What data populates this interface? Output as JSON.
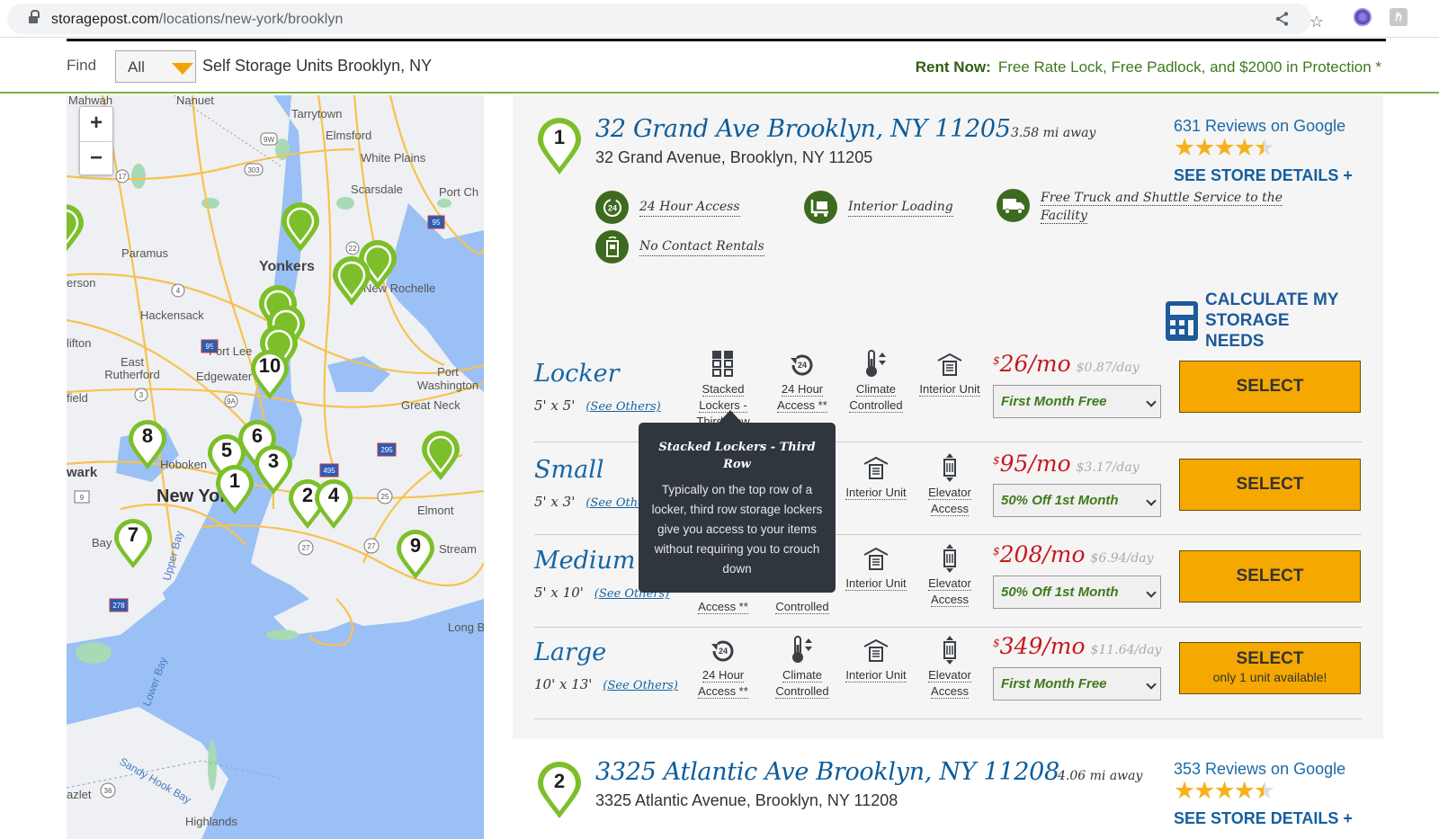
{
  "browser": {
    "url_host": "storagepost.com",
    "url_path": "/locations/new-york/brooklyn",
    "icons": [
      "lock-icon",
      "share-icon",
      "bookmark-star-icon",
      "extension-icon",
      "profile-icon"
    ]
  },
  "findbar": {
    "find_label": "Find",
    "filter_value": "All",
    "title": "Self Storage Units Brooklyn, NY",
    "rent_now_label": "Rent Now:",
    "rent_now_text": "Free Rate Lock, Free Padlock, and $2000 in Protection *"
  },
  "map": {
    "zoom_in": "+",
    "zoom_out": "−",
    "labels": [
      {
        "text": "Mahwah"
      },
      {
        "text": "Nanuet"
      },
      {
        "text": "Tarrytown"
      },
      {
        "text": "Elmsford"
      },
      {
        "text": "White Plains"
      },
      {
        "text": "Scarsdale"
      },
      {
        "text": "Port Ch"
      },
      {
        "text": "Paramus"
      },
      {
        "text": "Yonkers"
      },
      {
        "text": "erson"
      },
      {
        "text": "Hackensack"
      },
      {
        "text": "New Rochelle"
      },
      {
        "text": "lifton"
      },
      {
        "text": "Fort Lee"
      },
      {
        "text": "East Rutherford"
      },
      {
        "text": "Edgewater"
      },
      {
        "text": "Port Washington"
      },
      {
        "text": "Great Neck"
      },
      {
        "text": "field"
      },
      {
        "text": "Hoboken"
      },
      {
        "text": "wark"
      },
      {
        "text": "New York"
      },
      {
        "text": "Elmont"
      },
      {
        "text": "Stream"
      },
      {
        "text": "Bay"
      },
      {
        "text": "Upper Bay"
      },
      {
        "text": "Long B"
      },
      {
        "text": "Lower Bay"
      },
      {
        "text": "Sandy Hook Bay"
      },
      {
        "text": "azlet"
      },
      {
        "text": "Highlands"
      }
    ],
    "route_shields": [
      "9W",
      "303",
      "17",
      "4",
      "22",
      "95",
      "3",
      "9A",
      "295",
      "495",
      "25",
      "27",
      "27",
      "9",
      "278",
      "36"
    ],
    "numbered_pins": [
      "10",
      "8",
      "5",
      "6",
      "3",
      "1",
      "2",
      "4",
      "7",
      "9"
    ],
    "pin_color": "#7cbf2a"
  },
  "stores": [
    {
      "pin": "1",
      "title": "32 Grand Ave Brooklyn, NY 11205",
      "distance": "3.58 mi away",
      "address": "32 Grand Avenue, Brooklyn, NY 11205",
      "reviews": "631 Reviews on Google",
      "rating": 4.5,
      "details_link": "SEE STORE DETAILS +",
      "amenities": [
        {
          "icon": "24-hour-icon",
          "label": "24 Hour Access"
        },
        {
          "icon": "interior-loading-icon",
          "label": "Interior Loading"
        },
        {
          "icon": "truck-icon",
          "label": "Free Truck and Shuttle Service to the Facility"
        },
        {
          "icon": "no-contact-icon",
          "label": "No Contact Rentals"
        }
      ],
      "calculator": "CALCULATE MY STORAGE NEEDS",
      "units": [
        {
          "name": "Locker",
          "size": "5' x 5'",
          "see_others": "(See Others)",
          "features": [
            {
              "icon": "stacked-lockers-icon",
              "label": "Stacked Lockers - Third Row"
            },
            {
              "icon": "24-hour-icon",
              "label": "24 Hour Access **"
            },
            {
              "icon": "climate-icon",
              "label": "Climate Controlled"
            },
            {
              "icon": "interior-unit-icon",
              "label": "Interior Unit"
            }
          ],
          "price": "26/mo",
          "currency": "$",
          "per_day": "$0.87/day",
          "promo": "First Month Free",
          "select": "SELECT",
          "select_note": ""
        },
        {
          "name": "Small",
          "size": "5' x 3'",
          "see_others": "(See Others)",
          "features": [
            {
              "icon": "interior-unit-icon",
              "label": "Interior Unit"
            },
            {
              "icon": "elevator-icon",
              "label": "Elevator Access"
            }
          ],
          "price": "95/mo",
          "currency": "$",
          "per_day": "$3.17/day",
          "promo": "50% Off 1st Month",
          "select": "SELECT",
          "select_note": ""
        },
        {
          "name": "Medium",
          "size": "5' x 10'",
          "see_others": "(See Others)",
          "features": [
            {
              "icon": "24-hour-icon",
              "label": "Access **"
            },
            {
              "icon": "climate-icon",
              "label": "Controlled"
            },
            {
              "icon": "interior-unit-icon",
              "label": "Interior Unit"
            },
            {
              "icon": "elevator-icon",
              "label": "Elevator Access"
            }
          ],
          "price": "208/mo",
          "currency": "$",
          "per_day": "$6.94/day",
          "promo": "50% Off 1st Month",
          "select": "SELECT",
          "select_note": ""
        },
        {
          "name": "Large",
          "size": "10' x 13'",
          "see_others": "(See Others)",
          "features": [
            {
              "icon": "24-hour-icon",
              "label": "24 Hour Access **"
            },
            {
              "icon": "climate-icon",
              "label": "Climate Controlled"
            },
            {
              "icon": "interior-unit-icon",
              "label": "Interior Unit"
            },
            {
              "icon": "elevator-icon",
              "label": "Elevator Access"
            }
          ],
          "price": "349/mo",
          "currency": "$",
          "per_day": "$11.64/day",
          "promo": "First Month Free",
          "select": "SELECT",
          "select_note": "only 1 unit available!"
        }
      ]
    },
    {
      "pin": "2",
      "title": "3325 Atlantic Ave Brooklyn, NY 11208",
      "distance": "4.06 mi away",
      "address": "3325 Atlantic Avenue, Brooklyn, NY 11208",
      "reviews": "353 Reviews on Google",
      "rating": 4.5,
      "details_link": "SEE STORE DETAILS +"
    }
  ],
  "tooltip": {
    "title": "Stacked Lockers - Third Row",
    "body": "Typically on the top row of a locker, third row storage lockers give you access to your items without requiring you to crouch down"
  },
  "colors": {
    "brand_blue": "#0e5c9a",
    "brand_green": "#3d6a1e",
    "pin_green": "#7cbf2a",
    "price_red": "#c8171f",
    "select_orange": "#f5a800",
    "star_gold": "#f6b21b"
  }
}
